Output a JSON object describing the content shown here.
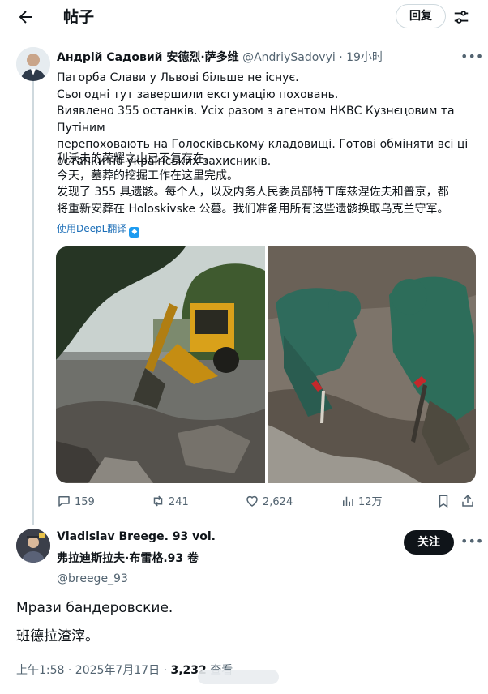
{
  "header": {
    "title": "帖子",
    "reply_label": "回复"
  },
  "tweet": {
    "author_name": "Андрій Садовий 安德烈·萨多维",
    "handle_time": "@AndriySadovyi · 19小时",
    "text_uk": [
      "Пагорба Слави у Львові більше не існує.",
      "Сьогодні тут завершили ексгумацію поховань.",
      "Виявлено 355 останків. Усіх разом з агентом НКВС Кузнєцовим та Путіним",
      "перепоховають на Голосківському кладовищі. Готові обміняти всі ці",
      "останки на українських захисників."
    ],
    "text_zh": [
      "利沃夫的荣耀之山已不复存在。",
      "今天，墓葬的挖掘工作在这里完成。",
      "发现了 355 具遗骸。每个人，以及内务人民委员部特工库兹涅佐夫和普京，都",
      "将重新安葬在 Holoskivske 公墓。我们准备用所有这些遗骸换取乌克兰守军。"
    ],
    "translate_label": "使用DeepL翻译",
    "stats": {
      "replies": "159",
      "retweets": "241",
      "likes": "2,624",
      "views": "12万"
    }
  },
  "reply": {
    "name_line1": "Vladislav Breege. 93 vol.",
    "name_line2": "弗拉迪斯拉夫·布雷格.93 卷",
    "handle": "@breege_93",
    "follow_label": "关注",
    "text_line1": "Мрази бандеровские.",
    "text_line2": "班德拉渣滓。",
    "time": "上午1:58 · 2025年7月17日 · ",
    "views_count": "3,232",
    "views_label": " 查看"
  }
}
